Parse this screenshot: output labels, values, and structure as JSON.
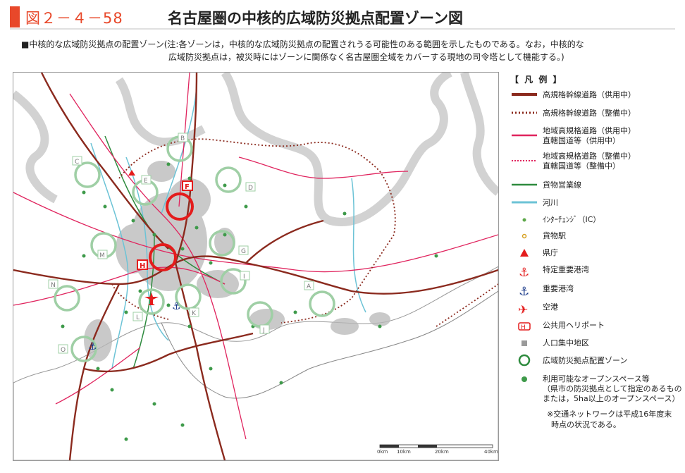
{
  "header": {
    "figure_number": "図２－４－58",
    "title": "名古屋圏の中核的広域防災拠点配置ゾーン図"
  },
  "caption": {
    "line1": "■中核的な広域防災拠点の配置ゾーン(注:各ゾーンは，中核的な広域防災拠点の配置されうる可能性のある範囲を示したものである。なお，中核的な",
    "line2": "広域防災拠点は，被災時にはゾーンに関係なく名古屋圏全域をカバーする現地の司令塔として機能する。)"
  },
  "legend": {
    "title": "【 凡 例 】",
    "items": [
      {
        "label": "高規格幹線道路（供用中）"
      },
      {
        "label": "高規格幹線道路（整備中）"
      },
      {
        "label": "地域高規格道路（供用中）",
        "label2": "直轄国道等（供用中）"
      },
      {
        "label": "地域高規格道路（整備中）",
        "label2": "直轄国道等（整備中）"
      },
      {
        "label": "貨物営業線"
      },
      {
        "label": "河川"
      },
      {
        "label": "ｲﾝﾀｰﾁｪﾝｼﾞ（IC）"
      },
      {
        "label": "貨物駅"
      },
      {
        "label": "県庁"
      },
      {
        "label": "特定重要港湾"
      },
      {
        "label": "重要港湾"
      },
      {
        "label": "空港"
      },
      {
        "label": "公共用ヘリポート"
      },
      {
        "label": "人口集中地区"
      },
      {
        "label": "広域防災拠点配置ゾーン"
      },
      {
        "label": "利用可能なオープンスペース等",
        "label2": "（県市の防災拠点として指定のあるもの",
        "label3": "または，5ha以上のオープンスペース）"
      }
    ],
    "note1": "※交通ネットワークは平成16年度末",
    "note2": "時点の状況である。"
  },
  "colors": {
    "expressway": "#8b2a1e",
    "regional_road": "#e0245e",
    "freight_rail": "#2e8b3e",
    "river": "#6cc3d6",
    "zone": "#9fcfa5",
    "core_zone": "#e41c1c",
    "accent": "#e8482a"
  },
  "map": {
    "zones": [
      "A",
      "B",
      "C",
      "D",
      "E",
      "F",
      "G",
      "H",
      "I",
      "J",
      "K",
      "L",
      "M",
      "N",
      "O"
    ],
    "scale_labels": [
      "0km",
      "10km",
      "20km",
      "40km"
    ]
  }
}
